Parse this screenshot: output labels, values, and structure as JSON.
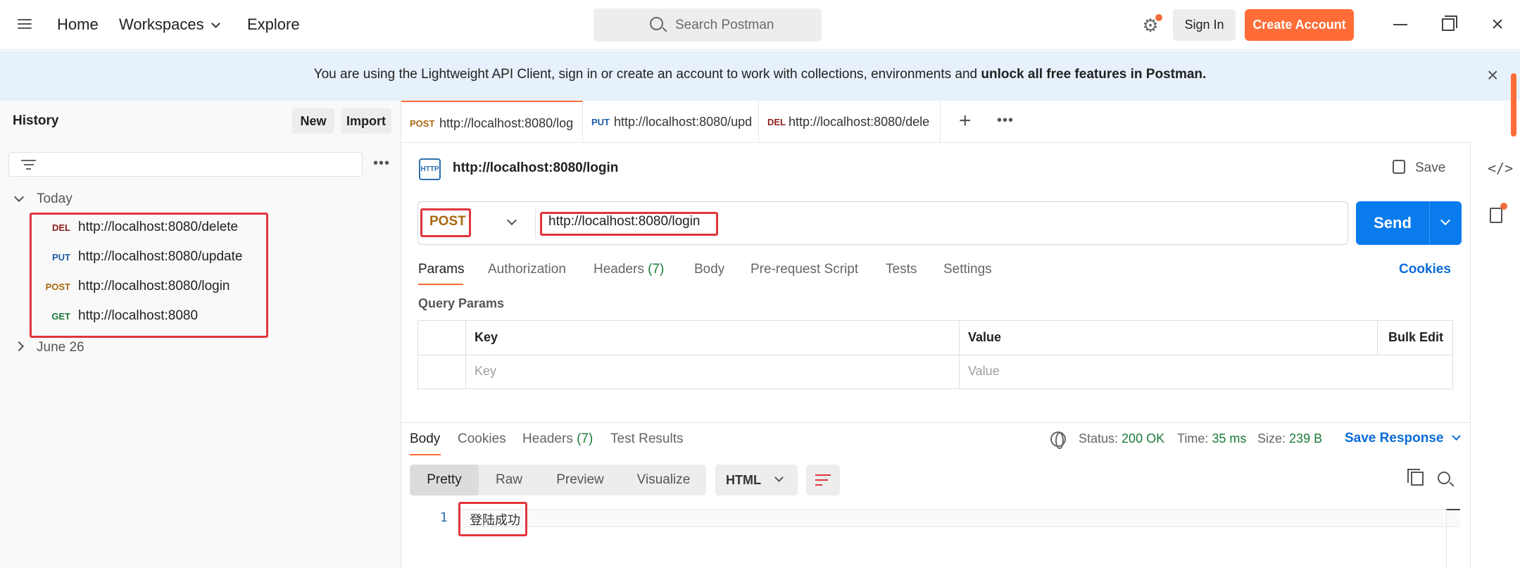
{
  "topbar": {
    "nav": [
      "Home",
      "Workspaces",
      "Explore"
    ],
    "search_placeholder": "Search Postman",
    "sign_in": "Sign In",
    "create_account": "Create Account"
  },
  "banner": {
    "text": "You are using the Lightweight API Client, sign in or create an account to work with collections, environments and ",
    "bold": "unlock all free features in Postman."
  },
  "sidebar": {
    "title": "History",
    "new_label": "New",
    "import_label": "Import",
    "groups": [
      {
        "label": "Today",
        "items": [
          {
            "method": "DEL",
            "url": "http://localhost:8080/delete"
          },
          {
            "method": "PUT",
            "url": "http://localhost:8080/update"
          },
          {
            "method": "POST",
            "url": "http://localhost:8080/login"
          },
          {
            "method": "GET",
            "url": "http://localhost:8080"
          }
        ]
      },
      {
        "label": "June 26"
      }
    ]
  },
  "tabs": [
    {
      "method": "POST",
      "url": "http://localhost:8080/log"
    },
    {
      "method": "PUT",
      "url": "http://localhost:8080/upd"
    },
    {
      "method": "DEL",
      "url": "http://localhost:8080/dele"
    }
  ],
  "request": {
    "icon_text": "HTTP",
    "title": "http://localhost:8080/login",
    "save_label": "Save",
    "method": "POST",
    "url": "http://localhost:8080/login",
    "send_label": "Send",
    "tabs": [
      "Params",
      "Authorization",
      "Headers",
      "Body",
      "Pre-request Script",
      "Tests",
      "Settings"
    ],
    "headers_count": "(7)",
    "cookies_label": "Cookies",
    "query_params_label": "Query Params",
    "table_headers": [
      "Key",
      "Value",
      "Bulk Edit"
    ],
    "key_placeholder": "Key",
    "value_placeholder": "Value"
  },
  "response": {
    "tabs": [
      "Body",
      "Cookies",
      "Headers",
      "Test Results"
    ],
    "headers_count": "(7)",
    "status_label": "Status:",
    "status_value": "200 OK",
    "time_label": "Time:",
    "time_value": "35 ms",
    "size_label": "Size:",
    "size_value": "239 B",
    "save_response": "Save Response",
    "formats": [
      "Pretty",
      "Raw",
      "Preview",
      "Visualize"
    ],
    "language": "HTML",
    "line_number": "1",
    "body_text": "登陆成功"
  }
}
